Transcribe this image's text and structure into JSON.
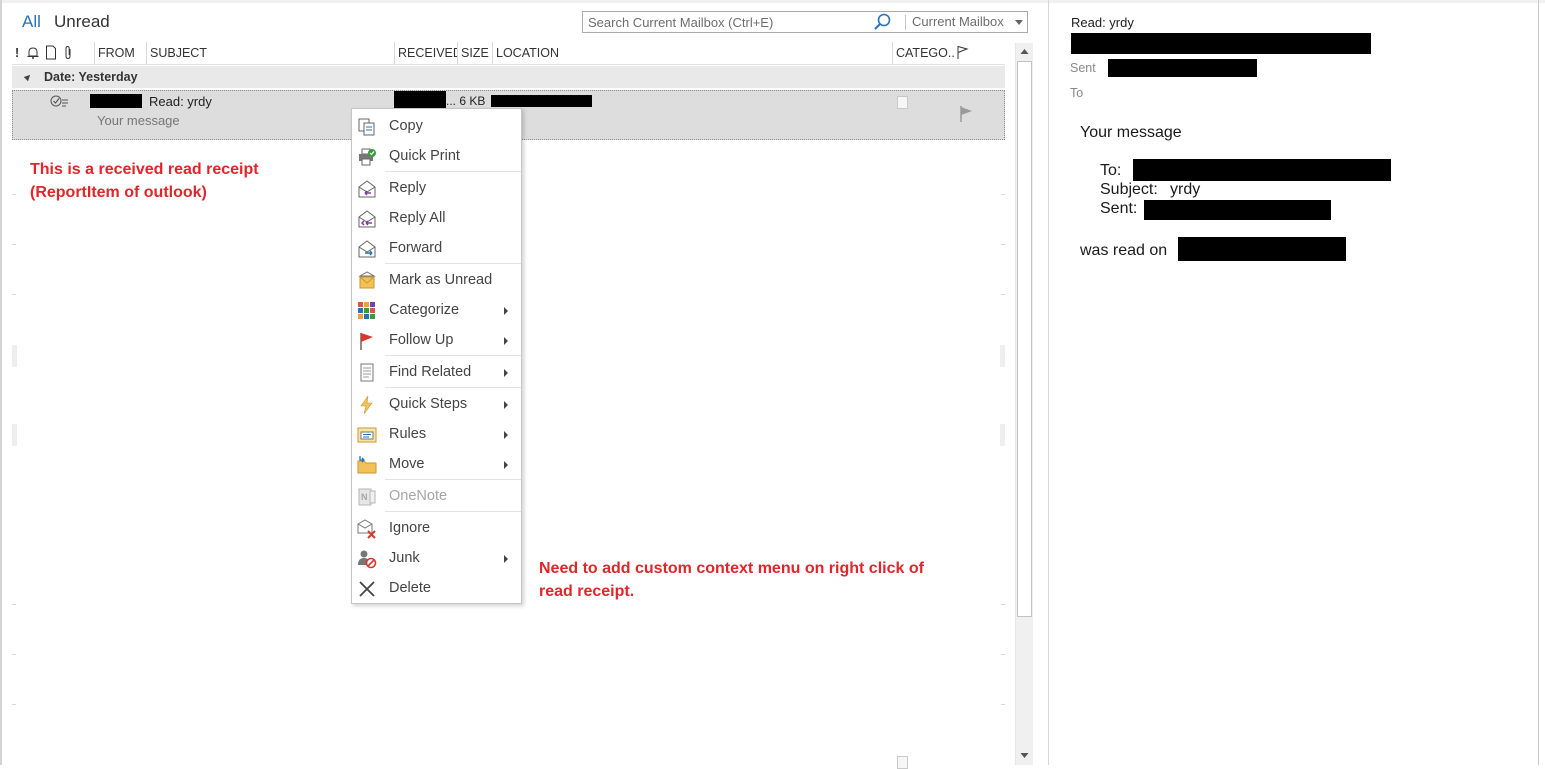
{
  "filters": {
    "all": "All",
    "unread": "Unread"
  },
  "search": {
    "placeholder": "Search Current Mailbox (Ctrl+E)",
    "scope": "Current Mailbox"
  },
  "columns": {
    "importance": "!",
    "from": "FROM",
    "subject": "SUBJECT",
    "received": "RECEIVED",
    "size": "SIZE",
    "location": "LOCATION",
    "categories": "CATEGO..."
  },
  "group": {
    "label": "Date: Yesterday"
  },
  "message": {
    "subject": "Read: yrdy",
    "preview": "Your message",
    "size": "... 6 KB"
  },
  "annotations": {
    "left_line1": "This is a received read receipt",
    "left_line2": "(ReportItem of outlook)",
    "right_line1": "Need to add custom context menu on right click of",
    "right_line2": "read receipt."
  },
  "context_menu": {
    "items": [
      {
        "label": "Copy",
        "icon": "copy-icon",
        "submenu": false,
        "disabled": false
      },
      {
        "label": "Quick Print",
        "icon": "quick-print-icon",
        "submenu": false,
        "disabled": false
      },
      {
        "label": "Reply",
        "icon": "reply-icon",
        "submenu": false,
        "disabled": false
      },
      {
        "label": "Reply All",
        "icon": "reply-all-icon",
        "submenu": false,
        "disabled": false
      },
      {
        "label": "Forward",
        "icon": "forward-icon",
        "submenu": false,
        "disabled": false
      },
      {
        "label": "Mark as Unread",
        "icon": "mark-unread-icon",
        "submenu": false,
        "disabled": false
      },
      {
        "label": "Categorize",
        "icon": "categorize-icon",
        "submenu": true,
        "disabled": false
      },
      {
        "label": "Follow Up",
        "icon": "follow-up-flag-icon",
        "submenu": true,
        "disabled": false
      },
      {
        "label": "Find Related",
        "icon": "find-related-icon",
        "submenu": true,
        "disabled": false
      },
      {
        "label": "Quick Steps",
        "icon": "quick-steps-icon",
        "submenu": true,
        "disabled": false
      },
      {
        "label": "Rules",
        "icon": "rules-icon",
        "submenu": true,
        "disabled": false
      },
      {
        "label": "Move",
        "icon": "move-folder-icon",
        "submenu": true,
        "disabled": false
      },
      {
        "label": "OneNote",
        "icon": "onenote-icon",
        "submenu": false,
        "disabled": true
      },
      {
        "label": "Ignore",
        "icon": "ignore-icon",
        "submenu": false,
        "disabled": false
      },
      {
        "label": "Junk",
        "icon": "junk-icon",
        "submenu": true,
        "disabled": false
      },
      {
        "label": "Delete",
        "icon": "delete-icon",
        "submenu": false,
        "disabled": false
      }
    ]
  },
  "reading_pane": {
    "title": "Read: yrdy",
    "sent_label": "Sent",
    "to_label": "To",
    "body_heading": "Your message",
    "to_field": "To:",
    "subject_field": "Subject:",
    "subject_value": "yrdy",
    "sent_field": "Sent:",
    "read_on": "was read on"
  },
  "colors": {
    "accent": "#2a72b5",
    "annotation": "#e0262a",
    "selected_row": "#dddddd"
  }
}
